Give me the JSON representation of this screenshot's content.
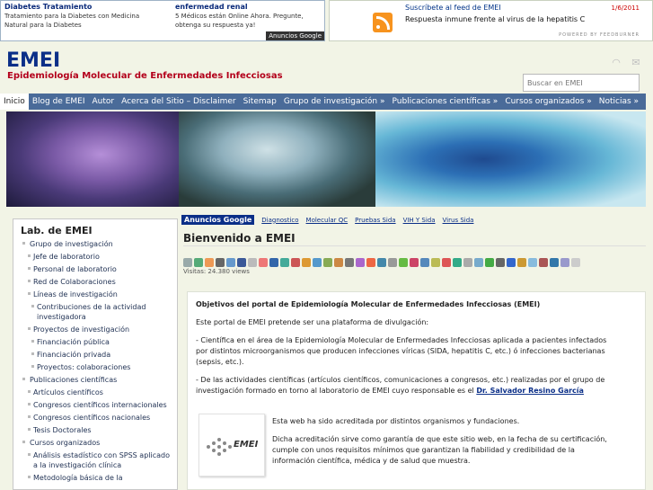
{
  "ads_top": {
    "ad1_title": "Diabetes Tratamiento",
    "ad1_text": "Tratamiento para la Diabetes con Medicina Natural para la Diabetes",
    "ad2_title": "enfermedad renal",
    "ad2_text": "5 Médicos están Online Ahora. Pregunte, obtenga su respuesta ya!",
    "badge": "Anuncios Google"
  },
  "feed": {
    "title": "Suscríbete al feed de EMEI",
    "date": "1/6/2011",
    "item": "Respuesta inmune frente al virus de la hepatitis C",
    "powered": "POWERED BY FEEDBURNER",
    "icon": "rss-icon"
  },
  "header": {
    "title": "EMEI",
    "subtitle": "Epidemiología Molecular de Enfermedades Infecciosas",
    "search_placeholder": "Buscar en EMEI",
    "icons": [
      "rss-icon",
      "mail-icon"
    ]
  },
  "nav": {
    "items": [
      "Inicio",
      "Blog de EMEI",
      "Autor",
      "Acerca del Sitio – Disclaimer",
      "Sitemap",
      "Grupo de investigación »",
      "Publicaciones científicas »",
      "Cursos organizados »",
      "Noticias »"
    ]
  },
  "sidebar": {
    "heading": "Lab. de EMEI",
    "items": [
      "Grupo de investigación",
      "Jefe de laboratorio",
      "Personal de laboratorio",
      "Red de Colaboraciones",
      "Líneas de investigación",
      "Contribuciones de la actividad investigadora",
      "Proyectos de investigación",
      "Financiación pública",
      "Financiación privada",
      "Proyectos: colaboraciones",
      "Publicaciones científicas",
      "Artículos científicos",
      "Congresos científicos internacionales",
      "Congresos científicos nacionales",
      "Tesis Doctorales",
      "Cursos organizados",
      "Análisis estadístico con SPSS aplicado a la investigación clínica",
      "Metodología básica de la"
    ]
  },
  "main": {
    "ad_badge": "Anuncios Google",
    "ad_links": [
      "Diagnostico",
      "Molecular QC",
      "Pruebas Sida",
      "VIH Y Sida",
      "Virus Sida"
    ],
    "page_title": "Bienvenido a EMEI",
    "views": "Visitas: 24.380 views",
    "article": {
      "heading": "Objetivos del portal de Epidemiología Molecular de Enfermedades Infecciosas (EMEI)",
      "p1": "Este portal de EMEI pretende ser una plataforma de divulgación:",
      "p2": "- Científica en el área de la Epidemiología Molecular de Enfermedades Infecciosas aplicada a pacientes infectados por distintos microorganismos que producen infecciones víricas (SIDA, hepatitis C, etc.) ó infecciones bacterianas (sepsis, etc.).",
      "p3": "- De las actividades científicas (artículos científicos, comunicaciones a congresos, etc.) realizadas por el grupo de investigación formado en torno al laboratorio de EMEI cuyo responsable es el",
      "p3_link": "Dr. Salvador Resino García",
      "seal_logo": "EMEI",
      "p4": "Esta web ha sido acreditada por distintos organismos y fundaciones.",
      "p5": "Dicha acreditación sirve como garantía de que este sitio web, en la fecha de su certificación, cumple con unos requisitos mínimos que garantizan la fiabilidad y credibilidad de la información científica, médica y de salud que muestra."
    }
  }
}
